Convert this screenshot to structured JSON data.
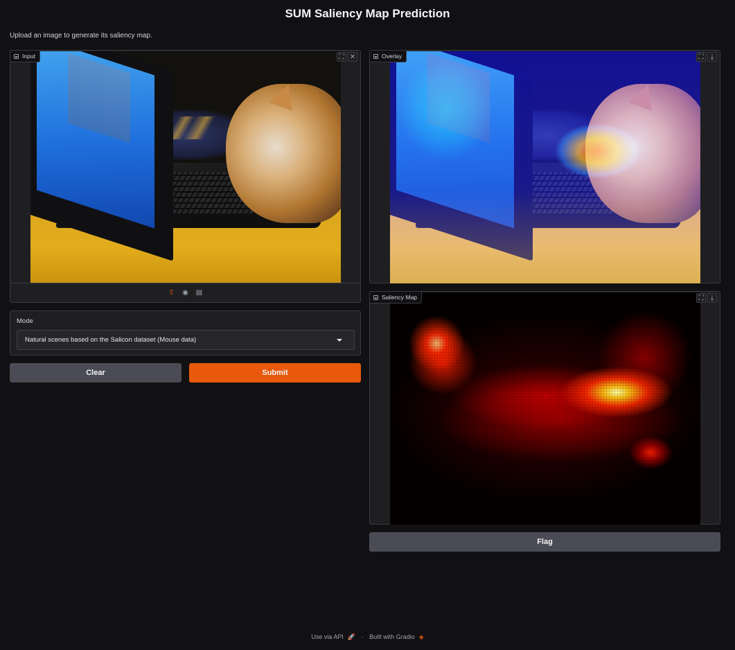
{
  "header": {
    "title": "SUM Saliency Map Prediction",
    "subtitle": "Upload an image to generate its saliency map."
  },
  "input_panel": {
    "label": "Input",
    "source_icons": [
      "upload-icon",
      "webcam-icon",
      "clipboard-icon"
    ]
  },
  "overlay_panel": {
    "label": "Overlay"
  },
  "saliency_panel": {
    "label": "Saliency Map"
  },
  "mode": {
    "label": "Mode",
    "selected": "Natural scenes based on the Salicon dataset (Mouse data)"
  },
  "buttons": {
    "clear": "Clear",
    "submit": "Submit",
    "flag": "Flag"
  },
  "footer": {
    "api_link": "Use via API",
    "separator": "·",
    "built_with": "Built with Gradio"
  },
  "colors": {
    "background": "#111113",
    "panel": "#1f1f22",
    "accent": "#e8590c",
    "secondary_button": "#4b4b55"
  }
}
